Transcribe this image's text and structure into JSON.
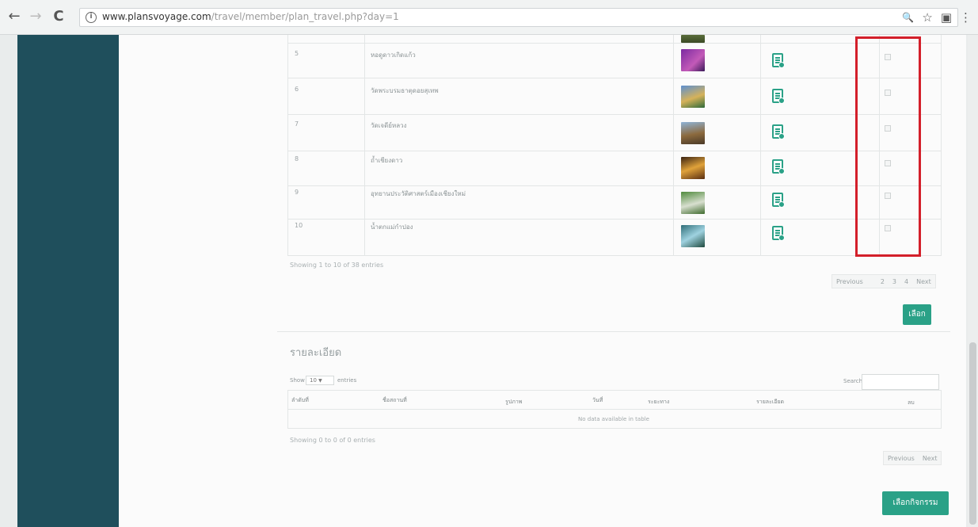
{
  "browser": {
    "url_host": "www.plansvoyage.com",
    "url_path": "/travel/member/plan_travel.php?day=1",
    "back_glyph": "←",
    "forward_glyph": "→",
    "reload_glyph": "C",
    "info_glyph": "i",
    "zoom_glyph": "🔍",
    "star_glyph": "☆",
    "ext_glyph": "▣",
    "menu_glyph": "⋮"
  },
  "places_table": {
    "rows": [
      {
        "no": "5",
        "name": "หอดูดาวเกิดแก้ว"
      },
      {
        "no": "6",
        "name": "วัดพระบรมธาตุดอยสุเทพ"
      },
      {
        "no": "7",
        "name": "วัดเจดีย์หลวง"
      },
      {
        "no": "8",
        "name": "ถ้ำเชียงดาว"
      },
      {
        "no": "9",
        "name": "อุทยานประวัติศาสตร์เมืองเชียงใหม่"
      },
      {
        "no": "10",
        "name": "น้ำตกแม่กำปอง"
      }
    ],
    "info": "Showing 1 to 10 of 38 entries",
    "pager": [
      "Previous",
      "2",
      "3",
      "4",
      "Next"
    ],
    "select_button": "เลือก"
  },
  "details": {
    "title": "รายละเอียด",
    "show_label": "Show",
    "entries_value": "10",
    "entries_label": "entries",
    "search_label": "Search:",
    "columns": [
      "ลำดับที่",
      "ชื่อสถานที่",
      "รูปภาพ",
      "วันที่",
      "ระยะทาง",
      "รายละเอียด",
      "ลบ"
    ],
    "empty": "No data available in table",
    "info": "Showing 0 to 0 of 0 entries",
    "pager": [
      "Previous",
      "Next"
    ],
    "confirm_button": "เลือกกิจกรรม"
  },
  "colors": {
    "sidebar": "#1f4f5c",
    "accent": "#2aa187",
    "highlight": "#d31f2a"
  }
}
